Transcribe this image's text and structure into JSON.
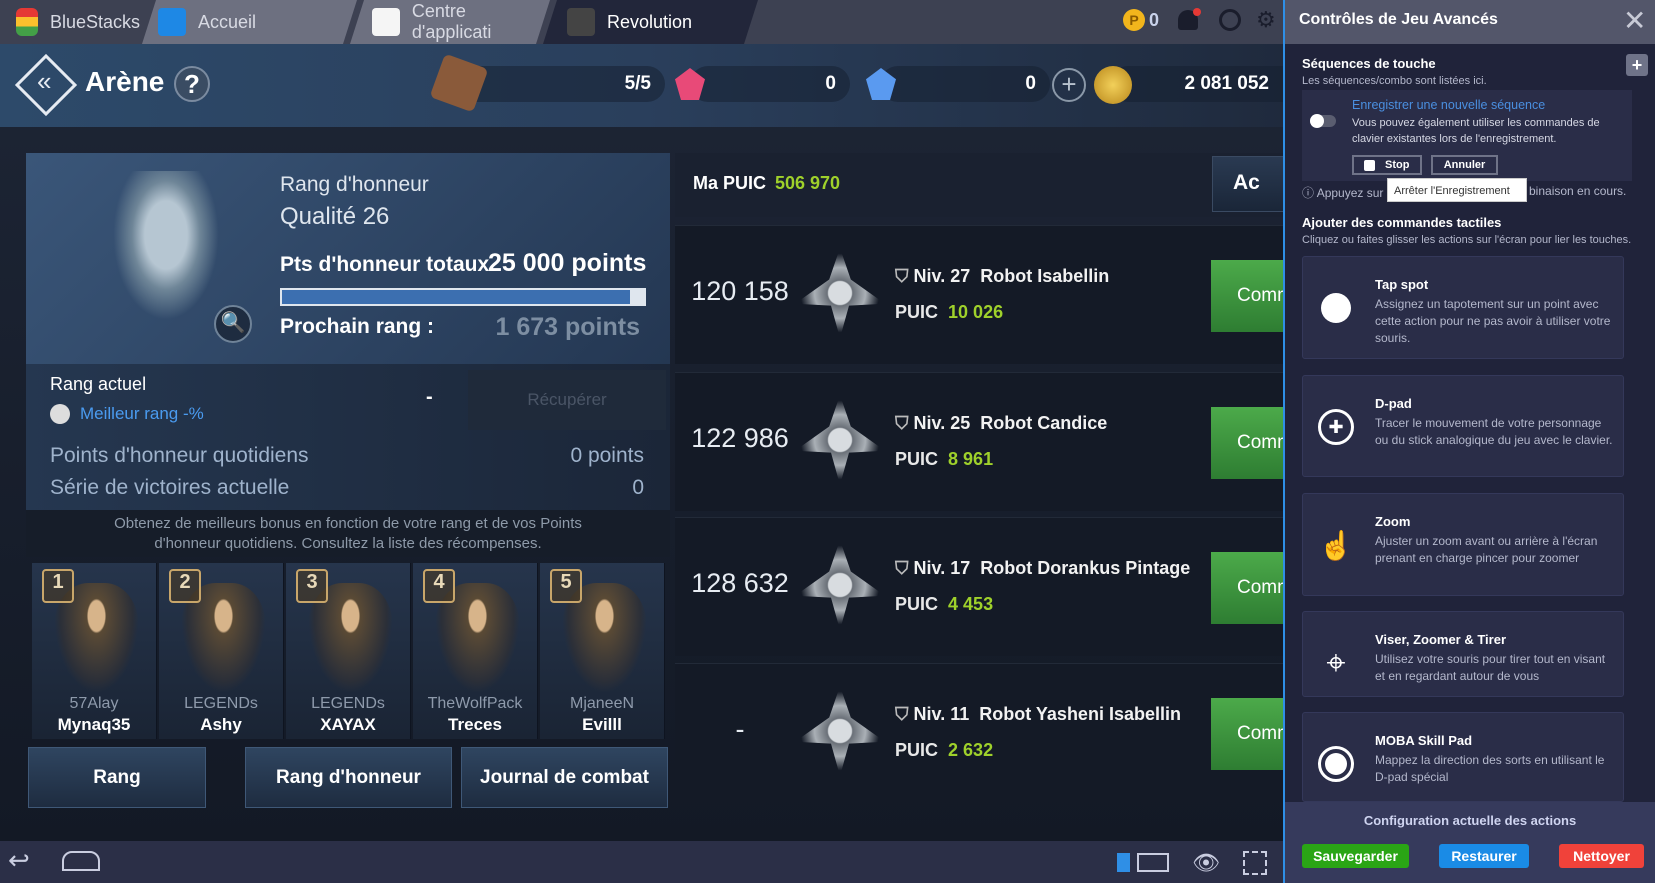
{
  "tabs": [
    {
      "label": "BlueStacks"
    },
    {
      "label": "Accueil"
    },
    {
      "label": "Centre d'applicati"
    },
    {
      "label": "Revolution"
    }
  ],
  "topbar": {
    "coins": "0"
  },
  "game": {
    "title": "Arène",
    "help": "?",
    "resources": {
      "tickets": "5/5",
      "red_gems": "0",
      "blue_gems": "0",
      "gold": "2 081 052"
    },
    "honor": {
      "heading": "Rang d'honneur",
      "quality": "Qualité 26",
      "total_label": "Pts d'honneur totaux",
      "total_value": "25 000 points",
      "progress": 0.96,
      "next_label": "Prochain rang :",
      "next_value": "1 673 points"
    },
    "current": {
      "label": "Rang actuel",
      "best": "Meilleur rang -%",
      "value": "-",
      "claim": "Récupérer",
      "daily_label": "Points d'honneur quotidiens",
      "daily_value": "0 points",
      "streak_label": "Série de victoires actuelle",
      "streak_value": "0",
      "info": "Obtenez de meilleurs bonus en fonction de votre rang et de vos Points d'honneur quotidiens. Consultez la liste des récompenses."
    },
    "top_players": [
      {
        "rank": "1",
        "guild": "57Alay",
        "name": "Mynaq35"
      },
      {
        "rank": "2",
        "guild": "LEGENDs",
        "name": "Ashy"
      },
      {
        "rank": "3",
        "guild": "LEGENDs",
        "name": "XAYAX"
      },
      {
        "rank": "4",
        "guild": "TheWolfPack",
        "name": "Treces"
      },
      {
        "rank": "5",
        "guild": "MjaneeN",
        "name": "Evilll"
      }
    ],
    "buttons": {
      "rank": "Rang",
      "honor_rank": "Rang d'honneur",
      "combat_log": "Journal de combat"
    },
    "my_puic_label": "Ma PUIC",
    "my_puic_value": "506 970",
    "action_label": "Ac",
    "opponents": [
      {
        "rank": "120 158",
        "level": "Niv. 27",
        "name": "Robot Isabellin",
        "puic": "10 026"
      },
      {
        "rank": "122 986",
        "level": "Niv. 25",
        "name": "Robot Candice",
        "puic": "8 961"
      },
      {
        "rank": "128 632",
        "level": "Niv. 17",
        "name": "Robot Dorankus Pintage",
        "puic": "4 453"
      },
      {
        "rank": "-",
        "level": "Niv. 11",
        "name": "Robot Yasheni Isabellin",
        "puic": "2 632"
      }
    ],
    "puic_label": "PUIC",
    "fight_label": "Comm"
  },
  "panel": {
    "title": "Contrôles de Jeu Avancés",
    "seq_title": "Séquences de touche",
    "seq_sub": "Les séquences/combo sont listées ici.",
    "record_title": "Enregistrer une nouvelle séquence",
    "record_desc": "Vous pouvez également utiliser les commandes de clavier existantes lors de l'enregistrement.",
    "stop": "Stop",
    "cancel": "Annuler",
    "tooltip": "Arrêter l'Enregistrement",
    "hint_a": "Appuyez sur",
    "hint_b": "binaison en cours.",
    "touch_title": "Ajouter des commandes tactiles",
    "touch_sub": "Cliquez ou faites glisser les actions sur l'écran pour lier les touches.",
    "cards": [
      {
        "title": "Tap spot",
        "desc": "Assignez un tapotement sur un point avec cette action pour ne pas avoir à utiliser votre souris.",
        "icon": "circle-icon"
      },
      {
        "title": "D-pad",
        "desc": "Tracer le mouvement de votre personnage ou du stick analogique du jeu avec le clavier.",
        "icon": "dpad-icon"
      },
      {
        "title": "Zoom",
        "desc": "Ajuster un zoom avant ou arrière à l'écran prenant en charge pincer pour zoomer",
        "icon": "pinch-icon"
      },
      {
        "title": "Viser, Zoomer & Tirer",
        "desc": "Utilisez votre souris pour tirer tout en visant et en regardant autour de vous",
        "icon": "crosshair-icon"
      },
      {
        "title": "MOBA Skill Pad",
        "desc": "Mappez la direction des sorts en utilisant le D-pad spécial",
        "icon": "skillpad-icon"
      }
    ],
    "footer_title": "Configuration actuelle des actions",
    "save": "Sauvegarder",
    "restore": "Restaurer",
    "clear": "Nettoyer",
    "colors": {
      "save": "#2aa515",
      "restore": "#1a8be6",
      "clear": "#f0423a",
      "accent": "#2f8fe6"
    }
  }
}
